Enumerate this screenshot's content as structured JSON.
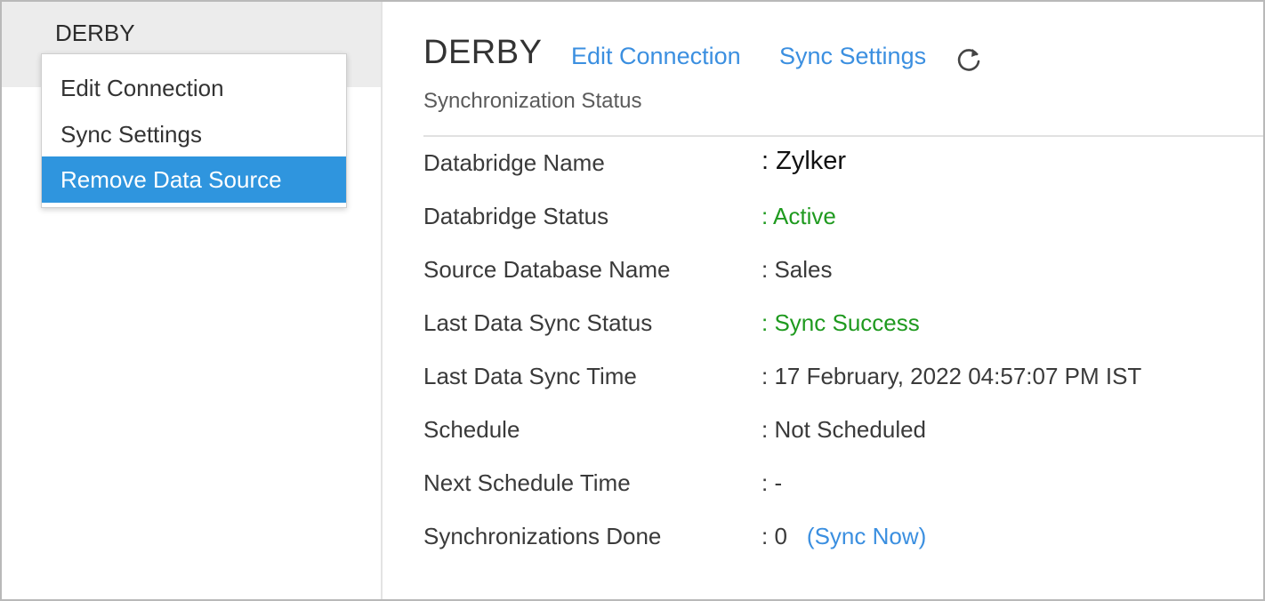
{
  "sidebar": {
    "title": "DERBY",
    "menu": [
      {
        "label": "Edit Connection"
      },
      {
        "label": "Sync Settings"
      },
      {
        "label": "Remove Data Source",
        "selected": true
      }
    ]
  },
  "header": {
    "title": "DERBY",
    "edit_label": "Edit Connection",
    "sync_label": "Sync Settings",
    "refresh_icon": "refresh-icon",
    "subtitle": "Synchronization Status"
  },
  "details": [
    {
      "key": "Databridge Name",
      "value": ": Zylker"
    },
    {
      "key": "Databridge Status",
      "value": ": Active"
    },
    {
      "key": "Source Database Name",
      "value": ": Sales"
    },
    {
      "key": "Last Data Sync Status",
      "value": ": Sync Success"
    },
    {
      "key": "Last Data Sync Time",
      "value": ": 17 February, 2022 04:57:07 PM IST"
    },
    {
      "key": "Schedule",
      "value": ": Not Scheduled"
    },
    {
      "key": "Next Schedule Time",
      "value": ": -"
    },
    {
      "key": "Synchronizations Done",
      "value": ": 0",
      "action": "(Sync Now)"
    }
  ],
  "colors": {
    "link": "#3b8fe0",
    "success": "#1f9a1f",
    "menu_selected": "#2f95de"
  }
}
